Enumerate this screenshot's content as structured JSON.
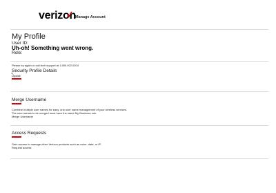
{
  "header": {
    "brand": "verizon",
    "brand_mark": "✓",
    "nav_link": "Manage Account"
  },
  "profile": {
    "title": "My Profile",
    "user_id_label": "User ID:",
    "error_message": "Uh-oh! Something went wrong.",
    "role_label": "Role:",
    "support_text": "Please try again or call tech support at 1.800.922.0204"
  },
  "security": {
    "title": "Security Profile Details",
    "update_link": "Update"
  },
  "merge": {
    "title": "Merge Username",
    "description_line1": "Combine multiple user names for easy, one user name management of your wireless services.",
    "description_line2": "The user names to be merged must have the same My Business role.",
    "link": "Merge Username"
  },
  "access": {
    "title": "Access Requests",
    "description": "Gain access to manage other Verizon products such as voice, data, or IP.",
    "link": "Request access"
  },
  "colors": {
    "brand_red": "#cd040b",
    "divider": "#d8d8d8"
  }
}
